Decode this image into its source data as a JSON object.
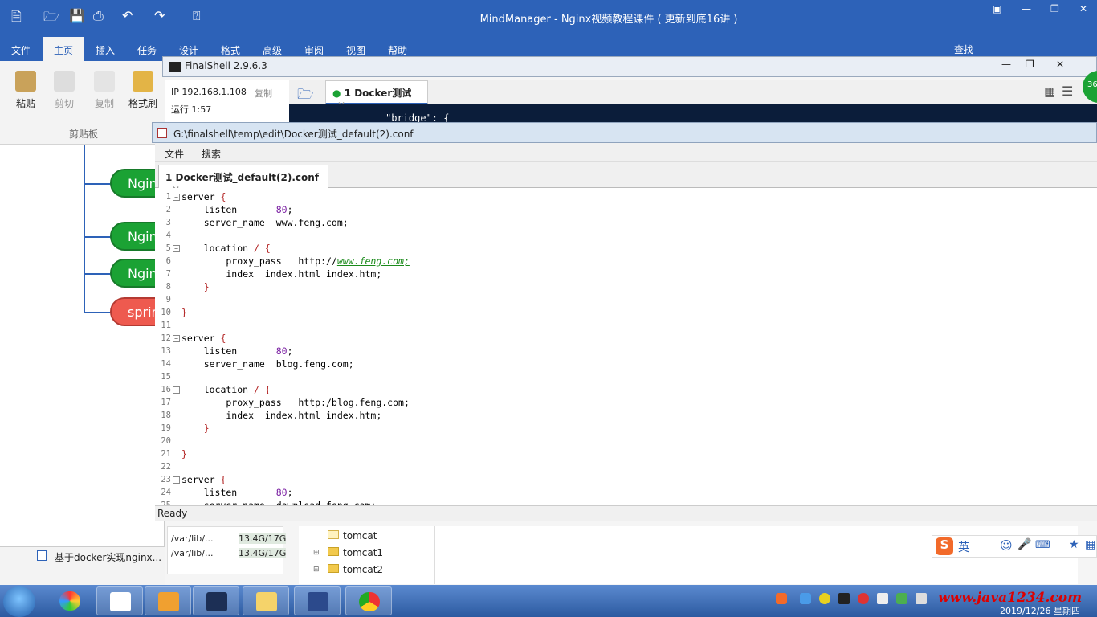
{
  "mindmanager": {
    "title": "MindManager - Nginx视频教程课件 ( 更新到底16讲 )",
    "menu": [
      "文件",
      "主页",
      "插入",
      "任务",
      "设计",
      "格式",
      "高级",
      "审阅",
      "视图",
      "帮助"
    ],
    "active_menu": "主页",
    "search_label": "查找",
    "ribbon": {
      "paste": "粘贴",
      "cut": "剪切",
      "copy": "复制",
      "format_painter": "格式刷",
      "group_label": "剪贴板"
    },
    "nodes": [
      "Ngin",
      "Ngin",
      "Ngin",
      "sprin"
    ],
    "doc_tab": "基于docker实现nginx..."
  },
  "finalshell": {
    "title": "FinalShell 2.9.6.3",
    "ip": "IP 192.168.1.108",
    "copy": "复制",
    "uptime": "运行 1:57",
    "tab_label": "1 Docker测试",
    "terminal_line": "\"bridge\": {",
    "disk": [
      {
        "path": "/var/lib/...",
        "size": "13.4G/17G"
      },
      {
        "path": "/var/lib/...",
        "size": "13.4G/17G"
      }
    ],
    "tree": [
      "tomcat",
      "tomcat1",
      "tomcat2"
    ]
  },
  "editor": {
    "title": "G:\\finalshell\\temp\\edit\\Docker测试_default(2).conf",
    "menu": [
      "文件",
      "搜索"
    ],
    "tab_label": "1 Docker测试_default(2).conf",
    "status": "Ready",
    "lines": [
      {
        "n": "1",
        "fold": true,
        "html": "server <span class='k'>{</span>"
      },
      {
        "n": "2",
        "fold": false,
        "html": "    listen       <span class='n'>80</span>;"
      },
      {
        "n": "3",
        "fold": false,
        "html": "    server_name  www.feng.com;"
      },
      {
        "n": "4",
        "fold": false,
        "html": ""
      },
      {
        "n": "5",
        "fold": true,
        "html": "    location <span class='k'>/</span> <span class='k'>{</span>"
      },
      {
        "n": "6",
        "fold": false,
        "html": "        proxy_pass   http://<span class='u'>www.feng.com;</span>"
      },
      {
        "n": "7",
        "fold": false,
        "html": "        index  index.html index.htm;"
      },
      {
        "n": "8",
        "fold": false,
        "html": "    <span class='k'>}</span>"
      },
      {
        "n": "9",
        "fold": false,
        "html": ""
      },
      {
        "n": "10",
        "fold": false,
        "html": "<span class='k'>}</span>"
      },
      {
        "n": "11",
        "fold": false,
        "html": ""
      },
      {
        "n": "12",
        "fold": true,
        "html": "server <span class='k'>{</span>"
      },
      {
        "n": "13",
        "fold": false,
        "html": "    listen       <span class='n'>80</span>;"
      },
      {
        "n": "14",
        "fold": false,
        "html": "    server_name  blog.feng.com;"
      },
      {
        "n": "15",
        "fold": false,
        "html": ""
      },
      {
        "n": "16",
        "fold": true,
        "html": "    location <span class='k'>/</span> <span class='k'>{</span>"
      },
      {
        "n": "17",
        "fold": false,
        "html": "        proxy_pass   http:/blog.feng.com;"
      },
      {
        "n": "18",
        "fold": false,
        "html": "        index  index.html index.htm;"
      },
      {
        "n": "19",
        "fold": false,
        "html": "    <span class='k'>}</span>"
      },
      {
        "n": "20",
        "fold": false,
        "html": ""
      },
      {
        "n": "21",
        "fold": false,
        "html": "<span class='k'>}</span>"
      },
      {
        "n": "22",
        "fold": false,
        "html": ""
      },
      {
        "n": "23",
        "fold": true,
        "html": "server <span class='k'>{</span>"
      },
      {
        "n": "24",
        "fold": false,
        "html": "    listen       <span class='n'>80</span>;"
      },
      {
        "n": "25",
        "fold": false,
        "html": "    server_name  download.feng.com;"
      }
    ]
  },
  "taskbar": {
    "watermark": "www.java1234.com",
    "time": "2019/12/26 星期四",
    "ime_label": "英",
    "badge": "36"
  },
  "colors": {
    "mm_blue": "#2d62b8",
    "node_green": "#1ba234",
    "node_red": "#ee5a4f",
    "keyword": "#b22222",
    "number": "#7a1fa2",
    "link": "#1a8a1a"
  }
}
